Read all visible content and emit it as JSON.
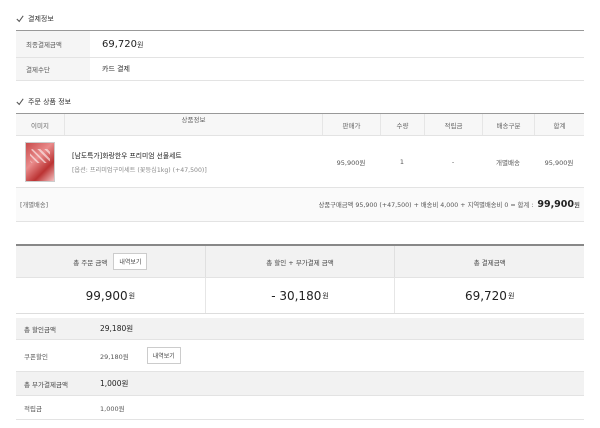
{
  "payment_section": {
    "title": "결제정보",
    "final_amount_label": "최종결제금액",
    "final_amount_value": "69,720",
    "final_amount_unit": "원",
    "method_label": "결제수단",
    "method_value": "카드 결제"
  },
  "order_section": {
    "title": "주문 상품 정보",
    "columns": [
      "이미지",
      "상품정보",
      "판매가",
      "수량",
      "적립금",
      "배송구분",
      "합계"
    ],
    "item": {
      "name": "[남도특가]화랑한우 프리미엄 선물세트",
      "option": "[옵션: 프리미엄구이세트 (꽃등심1kg) (+47,500)]",
      "price": "95,900원",
      "qty": "1",
      "point": "-",
      "shipping": "개별배송",
      "total": "95,900원"
    },
    "footer_left": "[개별배송]",
    "footer_summary": "상품구매금액 95,900 (+47,500) + 배송비 4,000 + 지역별배송비 0 = 합계 :",
    "footer_total": "99,900",
    "footer_total_unit": "원"
  },
  "summary": {
    "total_order_label": "총 주문 금액",
    "detail_button": "내역보기",
    "discount_label": "총 할인 + 부가결제 금액",
    "payment_label": "총 결제금액",
    "total_order_value": "99,900",
    "discount_value": "- 30,180",
    "payment_value": "69,720",
    "unit": "원"
  },
  "details": {
    "total_discount_label": "총 할인금액",
    "total_discount_value": "29,180원",
    "coupon_label": "쿠폰할인",
    "coupon_value": "29,180원",
    "coupon_button": "내역보기",
    "total_extra_label": "총 부가결제금액",
    "total_extra_value": "1,000원",
    "points_label": "적립금",
    "points_value": "1,000원"
  }
}
